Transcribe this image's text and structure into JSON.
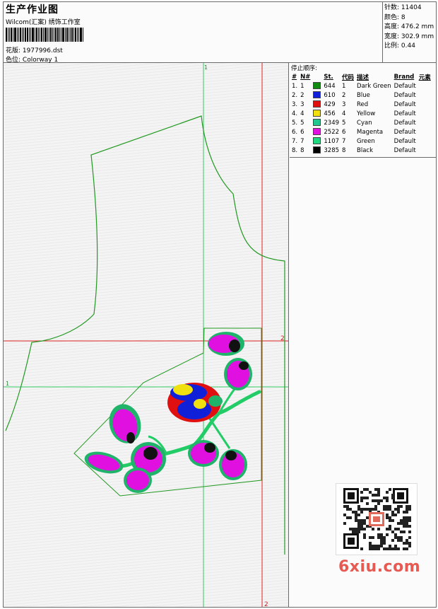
{
  "header": {
    "title": "生产作业图",
    "company": "Wilcom(汇案) 绣饰工作室",
    "design_label": "花版:",
    "design_value": "1977996.dst",
    "colorway_label": "色位:",
    "colorway_value": "Colorway 1"
  },
  "stats": {
    "stitches_label": "针数:",
    "stitches_value": "11404",
    "colors_label": "颜色:",
    "colors_value": "8",
    "height_label": "高度:",
    "height_value": "476.2 mm",
    "width_label": "宽度:",
    "width_value": "302.9 mm",
    "scale_label": "比例:",
    "scale_value": "0.44"
  },
  "color_panel": {
    "title": "停止顺序:",
    "columns": [
      "#",
      "N#",
      "St.",
      "代码",
      "描述",
      "Brand",
      "元素"
    ],
    "rows": [
      {
        "idx": "1.",
        "n": "1",
        "color": "#108a10",
        "st": "644",
        "code": "1",
        "desc": "Dark Green",
        "brand": "Default"
      },
      {
        "idx": "2.",
        "n": "2",
        "color": "#1020d8",
        "st": "610",
        "code": "2",
        "desc": "Blue",
        "brand": "Default"
      },
      {
        "idx": "3.",
        "n": "3",
        "color": "#e01010",
        "st": "429",
        "code": "3",
        "desc": "Red",
        "brand": "Default"
      },
      {
        "idx": "4.",
        "n": "4",
        "color": "#f0e010",
        "st": "456",
        "code": "4",
        "desc": "Yellow",
        "brand": "Default"
      },
      {
        "idx": "5.",
        "n": "5",
        "color": "#20c890",
        "st": "2349",
        "code": "5",
        "desc": "Cyan",
        "brand": "Default"
      },
      {
        "idx": "6.",
        "n": "6",
        "color": "#e010e0",
        "st": "2522",
        "code": "6",
        "desc": "Magenta",
        "brand": "Default"
      },
      {
        "idx": "7.",
        "n": "7",
        "color": "#20d880",
        "st": "1107",
        "code": "7",
        "desc": "Green",
        "brand": "Default"
      },
      {
        "idx": "8.",
        "n": "8",
        "color": "#000000",
        "st": "3285",
        "code": "8",
        "desc": "Black",
        "brand": "Default"
      }
    ]
  },
  "guides": {
    "green_v_label": "1",
    "green_h_label": "1",
    "red_h_label": "2",
    "red_v_label": "2"
  },
  "watermark": "6xiu.com",
  "colors": {
    "guide_green": "#33cc66",
    "guide_red": "#dd2222",
    "outline": "#229922"
  }
}
